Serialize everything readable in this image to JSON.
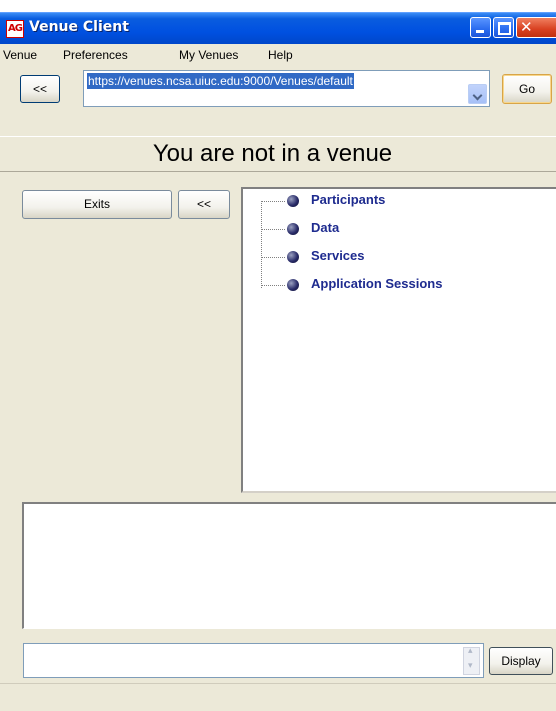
{
  "window": {
    "title": "Venue Client",
    "app_icon": "AG"
  },
  "menu": [
    "Venue",
    "Preferences",
    "My Venues",
    "Help"
  ],
  "address": {
    "back_label": "<<",
    "url": "https://venues.ncsa.uiuc.edu:9000/Venues/default",
    "go_label": "Go"
  },
  "venue_title": "You are not in a venue",
  "left_panel": {
    "exits_label": "Exits",
    "collapse_label": "<<"
  },
  "tree": [
    "Participants",
    "Data",
    "Services",
    "Application Sessions"
  ],
  "chat": {
    "input_value": "",
    "display_label": "Display"
  },
  "colors": {
    "title_bar": "#0050e0",
    "tree_text": "#1e2b8f",
    "selection": "#316ac5"
  }
}
